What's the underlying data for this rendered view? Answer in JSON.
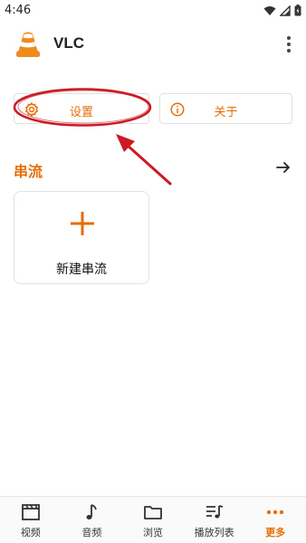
{
  "status_bar": {
    "time": "4:46",
    "icons": [
      "wifi-icon",
      "signal-icon",
      "battery-icon"
    ]
  },
  "app_bar": {
    "title": "VLC",
    "menu_icon": "more-vert-icon"
  },
  "actions": {
    "settings_label": "设置",
    "about_label": "关于"
  },
  "streams_section": {
    "title": "串流",
    "new_stream_label": "新建串流"
  },
  "bottom_nav": {
    "items": [
      {
        "label": "视频",
        "icon": "video-icon"
      },
      {
        "label": "音频",
        "icon": "music-note-icon"
      },
      {
        "label": "浏览",
        "icon": "folder-icon"
      },
      {
        "label": "播放列表",
        "icon": "playlist-icon"
      },
      {
        "label": "更多",
        "icon": "more-horiz-icon",
        "active": true
      }
    ]
  },
  "colors": {
    "accent": "#e66e0a",
    "annotation": "#cc1a24"
  }
}
